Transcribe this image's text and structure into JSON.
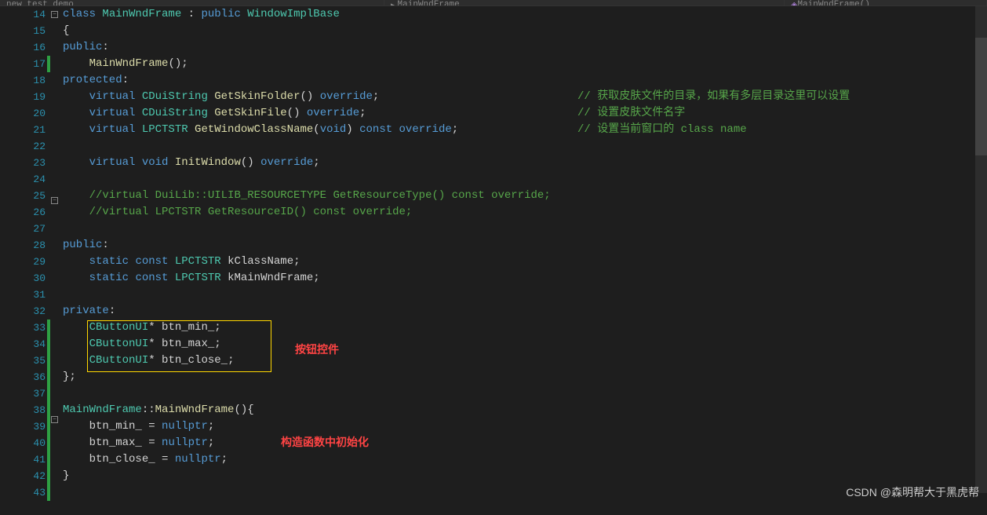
{
  "tabs": {
    "file": "new_test_demo",
    "breadcrumb1": "MainWndFrame",
    "breadcrumb2": "MainWndFrame()"
  },
  "gutter": {
    "start": 14,
    "end": 43
  },
  "annotations": {
    "button_label": "按钮控件",
    "ctor_label": "构造函数中初始化"
  },
  "watermark": "CSDN @森明帮大于黑虎帮",
  "code": {
    "l14": {
      "tokens": [
        [
          "kw",
          "class"
        ],
        [
          " "
        ],
        [
          "cls",
          "MainWndFrame"
        ],
        [
          " : "
        ],
        [
          "kw",
          "public"
        ],
        [
          " "
        ],
        [
          "cls",
          "WindowImplBase"
        ]
      ]
    },
    "l15": {
      "tokens": [
        [
          "punct",
          "{"
        ]
      ]
    },
    "l16": {
      "tokens": [
        [
          "kw",
          "public"
        ],
        [
          "punct",
          ":"
        ]
      ]
    },
    "l17": {
      "tokens": [
        [
          "    "
        ],
        [
          "func",
          "MainWndFrame"
        ],
        [
          "punct",
          "();"
        ]
      ]
    },
    "l18": {
      "tokens": [
        [
          "kw",
          "protected"
        ],
        [
          "punct",
          ":"
        ]
      ]
    },
    "l19": {
      "tokens": [
        [
          "    "
        ],
        [
          "kw",
          "virtual"
        ],
        [
          " "
        ],
        [
          "cls",
          "CDuiString"
        ],
        [
          " "
        ],
        [
          "func",
          "GetSkinFolder"
        ],
        [
          "punct",
          "() "
        ],
        [
          "kw",
          "override"
        ],
        [
          "punct",
          ";"
        ]
      ],
      "comment": "// 获取皮肤文件的目录，如果有多层目录这里可以设置"
    },
    "l20": {
      "tokens": [
        [
          "    "
        ],
        [
          "kw",
          "virtual"
        ],
        [
          " "
        ],
        [
          "cls",
          "CDuiString"
        ],
        [
          " "
        ],
        [
          "func",
          "GetSkinFile"
        ],
        [
          "punct",
          "() "
        ],
        [
          "kw",
          "override"
        ],
        [
          "punct",
          ";"
        ]
      ],
      "comment": "// 设置皮肤文件名字"
    },
    "l21": {
      "tokens": [
        [
          "    "
        ],
        [
          "kw",
          "virtual"
        ],
        [
          " "
        ],
        [
          "cls",
          "LPCTSTR"
        ],
        [
          " "
        ],
        [
          "func",
          "GetWindowClassName"
        ],
        [
          "punct",
          "("
        ],
        [
          "kw",
          "void"
        ],
        [
          "punct",
          ") "
        ],
        [
          "kw",
          "const"
        ],
        [
          " "
        ],
        [
          "kw",
          "override"
        ],
        [
          "punct",
          ";"
        ]
      ],
      "comment": "// 设置当前窗口的 class name"
    },
    "l22": {
      "tokens": [
        [
          ""
        ]
      ]
    },
    "l23": {
      "tokens": [
        [
          "    "
        ],
        [
          "kw",
          "virtual"
        ],
        [
          " "
        ],
        [
          "kw",
          "void"
        ],
        [
          " "
        ],
        [
          "func",
          "InitWindow"
        ],
        [
          "punct",
          "() "
        ],
        [
          "kw",
          "override"
        ],
        [
          "punct",
          ";"
        ]
      ]
    },
    "l24": {
      "tokens": [
        [
          ""
        ]
      ]
    },
    "l25": {
      "tokens": [
        [
          "    "
        ],
        [
          "comment",
          "//virtual DuiLib::UILIB_RESOURCETYPE GetResourceType() const override;"
        ]
      ]
    },
    "l26": {
      "tokens": [
        [
          "    "
        ],
        [
          "comment",
          "//virtual LPCTSTR GetResourceID() const override;"
        ]
      ]
    },
    "l27": {
      "tokens": [
        [
          ""
        ]
      ]
    },
    "l28": {
      "tokens": [
        [
          "kw",
          "public"
        ],
        [
          "punct",
          ":"
        ]
      ]
    },
    "l29": {
      "tokens": [
        [
          "    "
        ],
        [
          "kw",
          "static"
        ],
        [
          " "
        ],
        [
          "kw",
          "const"
        ],
        [
          " "
        ],
        [
          "cls",
          "LPCTSTR"
        ],
        [
          " "
        ],
        [
          "ident",
          "kClassName"
        ],
        [
          "punct",
          ";"
        ]
      ]
    },
    "l30": {
      "tokens": [
        [
          "    "
        ],
        [
          "kw",
          "static"
        ],
        [
          " "
        ],
        [
          "kw",
          "const"
        ],
        [
          " "
        ],
        [
          "cls",
          "LPCTSTR"
        ],
        [
          " "
        ],
        [
          "ident",
          "kMainWndFrame"
        ],
        [
          "punct",
          ";"
        ]
      ]
    },
    "l31": {
      "tokens": [
        [
          ""
        ]
      ]
    },
    "l32": {
      "tokens": [
        [
          "kw",
          "private"
        ],
        [
          "punct",
          ":"
        ]
      ]
    },
    "l33": {
      "tokens": [
        [
          "    "
        ],
        [
          "cls",
          "CButtonUI"
        ],
        [
          "punct",
          "* "
        ],
        [
          "ident",
          "btn_min_"
        ],
        [
          "punct",
          ";"
        ]
      ]
    },
    "l34": {
      "tokens": [
        [
          "    "
        ],
        [
          "cls",
          "CButtonUI"
        ],
        [
          "punct",
          "* "
        ],
        [
          "ident",
          "btn_max_"
        ],
        [
          "punct",
          ";"
        ]
      ]
    },
    "l35": {
      "tokens": [
        [
          "    "
        ],
        [
          "cls",
          "CButtonUI"
        ],
        [
          "punct",
          "* "
        ],
        [
          "ident",
          "btn_close_"
        ],
        [
          "punct",
          ";"
        ]
      ]
    },
    "l36": {
      "tokens": [
        [
          "punct",
          "};"
        ]
      ]
    },
    "l37": {
      "tokens": [
        [
          ""
        ]
      ]
    },
    "l38": {
      "tokens": [
        [
          "cls",
          "MainWndFrame"
        ],
        [
          "punct",
          "::"
        ],
        [
          "func",
          "MainWndFrame"
        ],
        [
          "punct",
          "(){"
        ]
      ]
    },
    "l39": {
      "tokens": [
        [
          "    "
        ],
        [
          "ident",
          "btn_min_"
        ],
        [
          " = "
        ],
        [
          "kw",
          "nullptr"
        ],
        [
          "punct",
          ";"
        ]
      ]
    },
    "l40": {
      "tokens": [
        [
          "    "
        ],
        [
          "ident",
          "btn_max_"
        ],
        [
          " = "
        ],
        [
          "kw",
          "nullptr"
        ],
        [
          "punct",
          ";"
        ]
      ]
    },
    "l41": {
      "tokens": [
        [
          "    "
        ],
        [
          "ident",
          "btn_close_"
        ],
        [
          " = "
        ],
        [
          "kw",
          "nullptr"
        ],
        [
          "punct",
          ";"
        ]
      ]
    },
    "l42": {
      "tokens": [
        [
          "punct",
          "}"
        ]
      ]
    },
    "l43": {
      "tokens": [
        [
          ""
        ]
      ]
    }
  },
  "changed_lines": [
    17,
    33,
    34,
    35,
    36,
    37,
    38,
    39,
    40,
    41,
    42,
    43
  ],
  "fold_markers": {
    "14": "−",
    "25": "−",
    "38": "−"
  }
}
